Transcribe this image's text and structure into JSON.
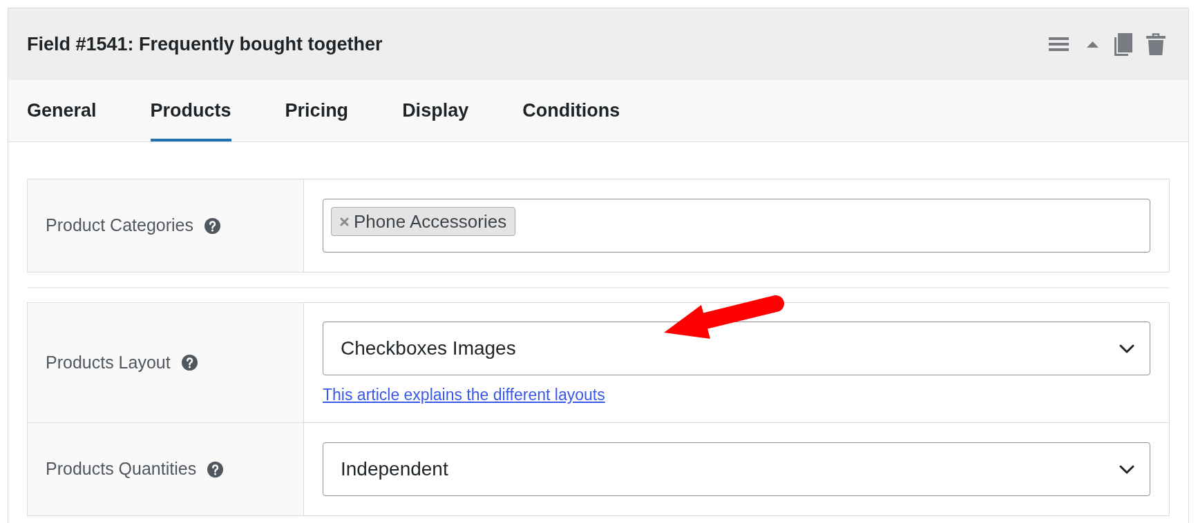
{
  "panel": {
    "title": "Field #1541: Frequently bought together"
  },
  "tabs": [
    {
      "label": "General",
      "selected": false
    },
    {
      "label": "Products",
      "selected": true
    },
    {
      "label": "Pricing",
      "selected": false
    },
    {
      "label": "Display",
      "selected": false
    },
    {
      "label": "Conditions",
      "selected": false
    }
  ],
  "sections": [
    {
      "rows": [
        {
          "kind": "tags",
          "label": "Product Categories",
          "tags": [
            "Phone Accessories"
          ]
        }
      ]
    },
    {
      "rows": [
        {
          "kind": "select",
          "label": "Products Layout",
          "value": "Checkboxes Images",
          "link": "This article explains the different layouts"
        },
        {
          "kind": "select",
          "label": "Products Quantities",
          "value": "Independent"
        }
      ]
    }
  ]
}
